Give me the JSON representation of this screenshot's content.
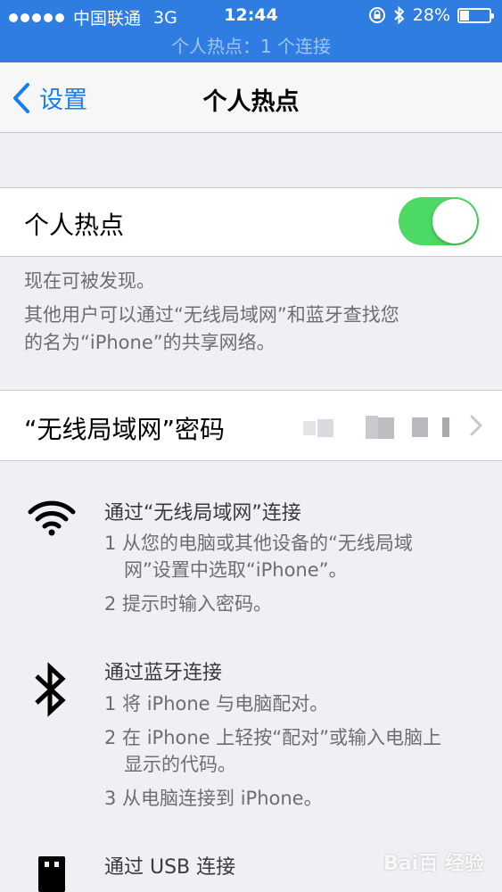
{
  "status_bar": {
    "carrier": "中国联通",
    "network": "3G",
    "time": "12:44",
    "battery": "28%",
    "battery_level": 0.28,
    "hotspot_banner": "个人热点：1 个连接"
  },
  "nav": {
    "back_label": "设置",
    "title": "个人热点"
  },
  "hotspot_toggle": {
    "label": "个人热点",
    "on": true
  },
  "discoverable": {
    "line1": "现在可被发现。",
    "line2": "其他用户可以通过“无线局域网”和蓝牙查找您",
    "line3": "的名为“iPhone”的共享网络。"
  },
  "wifi_password": {
    "label": "“无线局域网”密码"
  },
  "instructions": {
    "wifi": {
      "title": "通过“无线局域网”连接",
      "step1a": "1 从您的电脑或其他设备的“无线局域",
      "step1b": "网”设置中选取“iPhone”。",
      "step2": "2 提示时输入密码。"
    },
    "bluetooth": {
      "title": "通过蓝牙连接",
      "step1": "1 将 iPhone 与电脑配对。",
      "step2a": "2 在 iPhone 上轻按“配对”或输入电脑上",
      "step2b": "显示的代码。",
      "step3": "3 从电脑连接到 iPhone。"
    },
    "usb": {
      "title": "通过 USB 连接"
    }
  },
  "colors": {
    "status_bar_bg": "#2f7de1",
    "accent": "#1a7cf5",
    "toggle_on": "#4cd964"
  },
  "watermark": "Bai百 经验"
}
